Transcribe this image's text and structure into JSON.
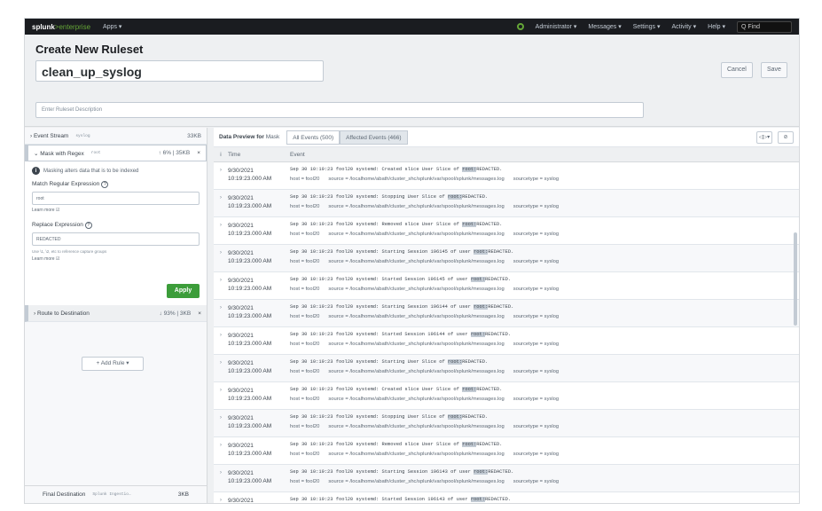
{
  "topbar": {
    "brand": "splunk",
    "brand_suffix": ">enterprise",
    "apps": "Apps ▾",
    "menus": [
      "Administrator ▾",
      "Messages ▾",
      "Settings ▾",
      "Activity ▾",
      "Help ▾"
    ],
    "find_placeholder": "Q Find"
  },
  "header": {
    "title": "Create New Ruleset",
    "ruleset_name": "clean_up_syslog",
    "description_placeholder": "Enter Ruleset Description",
    "cancel": "Cancel",
    "save": "Save"
  },
  "left": {
    "event_stream": {
      "label": "› Event Stream",
      "tag": "syslog",
      "size": "33KB"
    },
    "mask": {
      "label": "⌄ Mask with Regex",
      "tag": "root",
      "stat": "↑ 6% | 35KB",
      "close": "×"
    },
    "mask_note": "Masking alters data that is to be indexed",
    "match_label": "Match Regular Expression",
    "match_value": "root",
    "learn_more": "Learn more ☑",
    "replace_label": "Replace Expression",
    "replace_value": "REDACTED",
    "replace_hint": "Use \\1, \\2, etc to reference capture groups",
    "learn_more2": "Learn more ☑",
    "apply": "Apply",
    "route": {
      "label": "› Route to Destination",
      "stat": "↓ 93% | 3KB",
      "close": "×"
    },
    "add_rule": "+ Add Rule ▾",
    "final": {
      "label": "Final Destination",
      "tag": "Splunk Ingestio…",
      "size": "3KB"
    }
  },
  "preview": {
    "label": "Data Preview for",
    "label2": "Mask",
    "tab_all": "All Events (500)",
    "tab_affected": "Affected Events (466)",
    "col_info": "i",
    "col_time": "Time",
    "col_event": "Event",
    "rows": [
      {
        "date": "9/30/2021",
        "time": "10:19:23.000 AM",
        "pre": "Sep 30 10:19:23 fool20 systemd: Created slice User Slice of ",
        "hl": "root:",
        "post": "REDACTED."
      },
      {
        "date": "9/30/2021",
        "time": "10:19:23.000 AM",
        "pre": "Sep 30 10:19:23 fool20 systemd: Stopping User Slice of ",
        "hl": "root:",
        "post": "REDACTED."
      },
      {
        "date": "9/30/2021",
        "time": "10:19:23.000 AM",
        "pre": "Sep 30 10:19:23 fool20 systemd: Removed slice User Slice of ",
        "hl": "root:",
        "post": "REDACTED."
      },
      {
        "date": "9/30/2021",
        "time": "10:19:23.000 AM",
        "pre": "Sep 30 10:19:23 fool20 systemd: Starting Session 196145 of user ",
        "hl": "root:",
        "post": "REDACTED."
      },
      {
        "date": "9/30/2021",
        "time": "10:19:23.000 AM",
        "pre": "Sep 30 10:19:23 fool20 systemd: Started Session 196145 of user ",
        "hl": "root:",
        "post": "REDACTED."
      },
      {
        "date": "9/30/2021",
        "time": "10:19:23.000 AM",
        "pre": "Sep 30 10:19:23 fool20 systemd: Starting Session 196144 of user ",
        "hl": "root:",
        "post": "REDACTED."
      },
      {
        "date": "9/30/2021",
        "time": "10:19:23.000 AM",
        "pre": "Sep 30 10:19:23 fool20 systemd: Started Session 196144 of user ",
        "hl": "root:",
        "post": "REDACTED."
      },
      {
        "date": "9/30/2021",
        "time": "10:19:23.000 AM",
        "pre": "Sep 30 10:19:23 fool20 systemd: Starting User Slice of ",
        "hl": "root:",
        "post": "REDACTED."
      },
      {
        "date": "9/30/2021",
        "time": "10:19:23.000 AM",
        "pre": "Sep 30 10:19:23 fool20 systemd: Created slice User Slice of ",
        "hl": "root:",
        "post": "REDACTED."
      },
      {
        "date": "9/30/2021",
        "time": "10:19:23.000 AM",
        "pre": "Sep 30 10:19:23 fool20 systemd: Stopping User Slice of ",
        "hl": "root:",
        "post": "REDACTED."
      },
      {
        "date": "9/30/2021",
        "time": "10:19:23.000 AM",
        "pre": "Sep 30 10:19:23 fool20 systemd: Removed slice User Slice of ",
        "hl": "root:",
        "post": "REDACTED."
      },
      {
        "date": "9/30/2021",
        "time": "10:19:23.000 AM",
        "pre": "Sep 30 10:19:23 fool20 systemd: Starting Session 196143 of user ",
        "hl": "root:",
        "post": "REDACTED."
      },
      {
        "date": "9/30/2021",
        "time": "10:19:23.000 AM",
        "pre": "Sep 30 10:19:23 fool20 systemd: Started Session 196143 of user ",
        "hl": "root:",
        "post": "REDACTED."
      }
    ],
    "meta_host": "host = fool20",
    "meta_source": "source = /localhome/abath/cluster_shc/splunk/var/spool/splunk/messages.log",
    "meta_sourcetype": "sourcetype = syslog"
  }
}
